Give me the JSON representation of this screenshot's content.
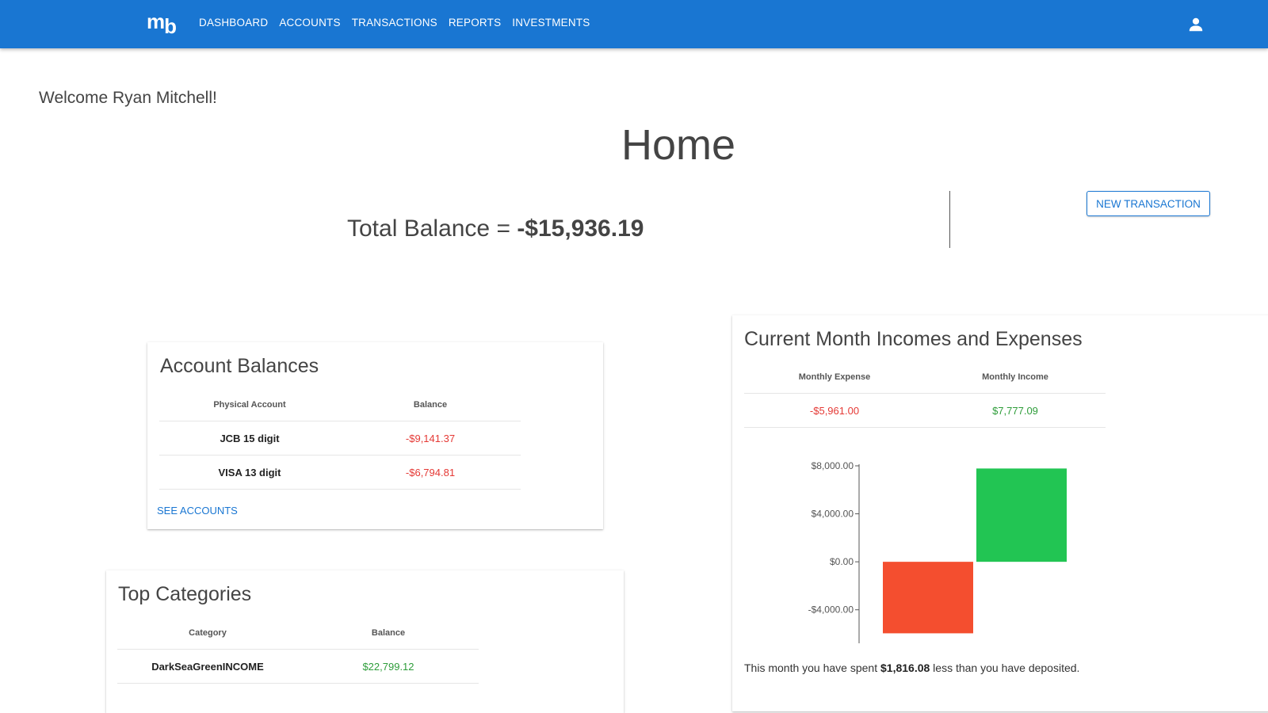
{
  "nav": {
    "logo": "mb",
    "items": [
      "DASHBOARD",
      "ACCOUNTS",
      "TRANSACTIONS",
      "REPORTS",
      "INVESTMENTS"
    ]
  },
  "welcome": "Welcome Ryan Mitchell!",
  "title": "Home",
  "total_balance": {
    "label": "Total Balance = ",
    "value": "-$15,936.19"
  },
  "new_transaction": "NEW TRANSACTION",
  "account_balances": {
    "title": "Account Balances",
    "columns": [
      "Physical Account",
      "Balance"
    ],
    "rows": [
      {
        "name": "JCB 15 digit",
        "balance": "-$9,141.37"
      },
      {
        "name": "VISA 13 digit",
        "balance": "-$6,794.81"
      }
    ],
    "link": "SEE ACCOUNTS"
  },
  "top_categories": {
    "title": "Top Categories",
    "columns": [
      "Category",
      "Balance"
    ],
    "rows": [
      {
        "name": "DarkSeaGreenINCOME",
        "balance": "$22,799.12"
      }
    ]
  },
  "incomes_expenses": {
    "title": "Current Month Incomes and Expenses",
    "columns": [
      "Monthly Expense",
      "Monthly Income"
    ],
    "expense": "-$5,961.00",
    "income": "$7,777.09",
    "summary_prefix": "This month you have spent ",
    "summary_amount": "$1,816.08",
    "summary_suffix": " less than you have deposited."
  },
  "chart_data": {
    "type": "bar",
    "categories": [
      "Monthly Expense",
      "Monthly Income"
    ],
    "values": [
      -5961.0,
      7777.09
    ],
    "colors": [
      "#f44e2f",
      "#22c553"
    ],
    "ylim": [
      -6000,
      8000
    ],
    "yticks": [
      8000,
      4000,
      0,
      -4000
    ],
    "ytick_labels": [
      "$8,000.00",
      "$4,000.00",
      "$0.00",
      "-$4,000.00"
    ]
  },
  "colors": {
    "primary": "#1976d2",
    "negative": "#e53935",
    "positive": "#2e9d3a"
  }
}
